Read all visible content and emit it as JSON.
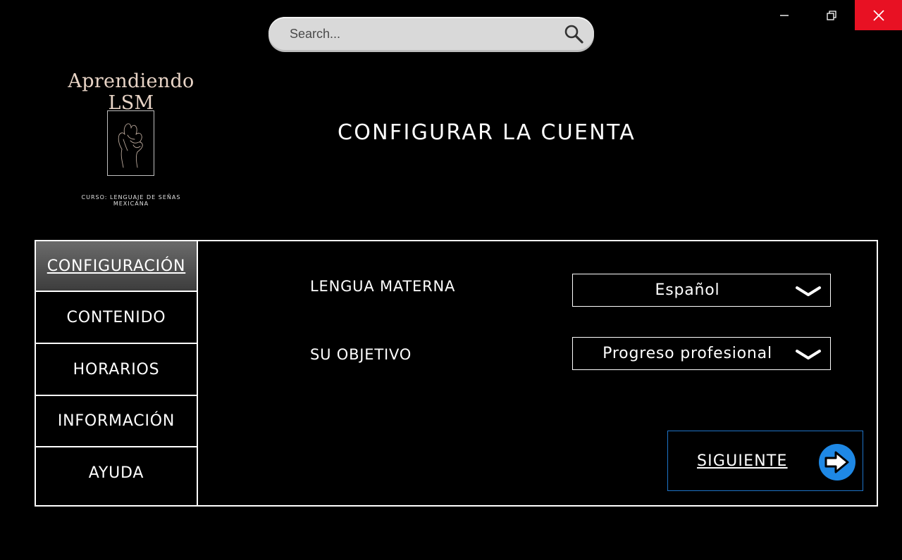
{
  "window": {
    "minimize_icon": "minimize-icon",
    "restore_icon": "restore-icon",
    "close_icon": "close-icon",
    "close_color": "#e81123"
  },
  "search": {
    "placeholder": "Search...",
    "icon": "search-icon"
  },
  "brand": {
    "title": "Aprendiendo LSM",
    "subtitle": "CURSO: LENGUAJE DE SEÑAS MEXICANA",
    "logo_icon": "hand-sign-icon"
  },
  "page_title": "CONFIGURAR LA CUENTA",
  "sidebar": {
    "items": [
      {
        "label": "CONFIGURACIÓN",
        "active": true
      },
      {
        "label": "CONTENIDO",
        "active": false
      },
      {
        "label": "HORARIOS",
        "active": false
      },
      {
        "label": "INFORMACIÓN",
        "active": false
      },
      {
        "label": "AYUDA",
        "active": false
      }
    ]
  },
  "form": {
    "language": {
      "label": "LENGUA MATERNA",
      "value": "Español",
      "icon": "chevron-down-icon"
    },
    "goal": {
      "label": "SU OBJETIVO",
      "value": "Progreso profesional",
      "icon": "chevron-down-icon"
    }
  },
  "next_button": {
    "label": "SIGUIENTE",
    "icon": "arrow-right-circle-icon",
    "accent": "#1e88e5"
  }
}
